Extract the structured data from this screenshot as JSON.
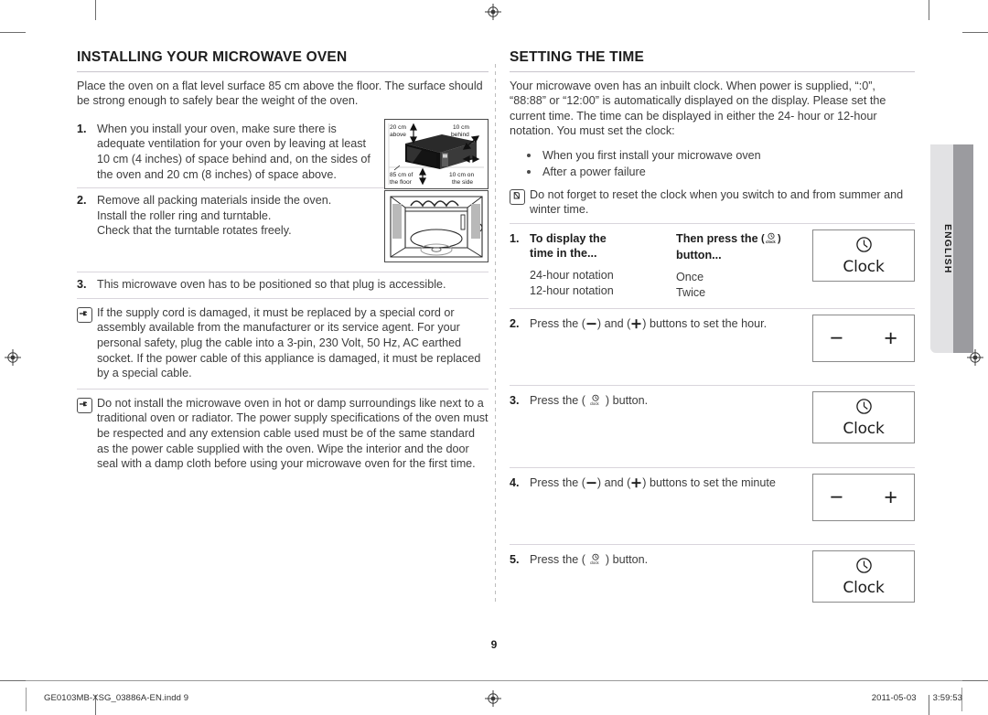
{
  "page": {
    "number": "9",
    "language_tab": "ENGLISH"
  },
  "left_column": {
    "heading": "INSTALLING YOUR MICROWAVE OVEN",
    "intro": "Place the oven on a flat level surface 85 cm above the floor. The surface should be strong enough to safely bear the weight of the oven.",
    "steps": [
      {
        "number": "1.",
        "text": "When you install your oven, make sure there is adequate ventilation for your oven by leaving at least 10 cm (4 inches) of space behind and, on the sides of the oven and 20 cm (8 inches) of space above.",
        "illustration": "oven-clearance-diagram",
        "illustration_labels": {
          "above": "20 cm above",
          "behind": "10 cm behind",
          "floor": "85 cm of the floor",
          "side": "10 cm on the side"
        }
      },
      {
        "number": "2.",
        "text": "Remove all packing materials inside the oven. Install the roller ring and turntable. Check that the turntable rotates freely.",
        "illustration": "oven-interior-turntable-diagram"
      },
      {
        "number": "3.",
        "text": "This microwave oven has to be positioned so that plug is accessible."
      }
    ],
    "notes": [
      {
        "icon": "pointing-hand-icon",
        "text": "If the supply cord is damaged, it must be replaced by a special cord or assembly available from the manufacturer or its service agent. For your personal safety, plug the cable into a 3-pin, 230 Volt, 50 Hz, AC earthed socket. If the power cable of this appliance is damaged, it must be replaced by a special cable."
      },
      {
        "icon": "pointing-hand-icon",
        "text": "Do not install the microwave oven in hot or damp surroundings like next to a traditional oven or radiator. The power supply specifications of the oven must be respected and any extension cable used must be of the same standard as the power cable supplied with the oven. Wipe the interior and the door seal with a damp cloth before using your microwave oven for the first time."
      }
    ]
  },
  "right_column": {
    "heading": "SETTING THE TIME",
    "intro": "Your microwave oven has an inbuilt clock. When power is supplied, “:0”, “88:88” or “12:00” is automatically displayed on the display. Please set the current time. The time can be displayed in either the 24- hour or 12-hour notation. You must set the clock:",
    "bullets": [
      "When you first install your microwave oven",
      "After a power failure"
    ],
    "note": {
      "icon": "note-pen-icon",
      "text": "Do not forget to reset the clock when you switch to and from summer and winter time."
    },
    "steps": [
      {
        "number": "1.",
        "table": {
          "headers": [
            "To display the time in the...",
            "Then press the (clock) button..."
          ],
          "rows": [
            [
              "24-hour notation",
              "Once"
            ],
            [
              "12-hour notation",
              "Twice"
            ]
          ]
        },
        "button": {
          "type": "clock",
          "label": "Clock"
        }
      },
      {
        "number": "2.",
        "text_parts": [
          "Press the (",
          ") and (",
          ") buttons to set the hour."
        ],
        "button": {
          "type": "plusminus",
          "minus": "−",
          "plus": "+"
        }
      },
      {
        "number": "3.",
        "text_parts": [
          "Press the (",
          ") button."
        ],
        "button": {
          "type": "clock",
          "label": "Clock"
        }
      },
      {
        "number": "4.",
        "text_parts": [
          "Press the (",
          ") and (",
          ") buttons to set the minute"
        ],
        "button": {
          "type": "plusminus",
          "minus": "−",
          "plus": "+"
        }
      },
      {
        "number": "5.",
        "text_parts": [
          "Press the (",
          ") button."
        ],
        "button": {
          "type": "clock",
          "label": "Clock"
        }
      }
    ]
  },
  "footer": {
    "file": "GE0103MB-XSG_03886A-EN.indd   9",
    "date": "2011-05-03",
    "time": "3:59:53"
  },
  "colors": {
    "text": "#3c3c3c",
    "heading": "#1d1d1d",
    "rule": "#d9d5dc",
    "tab_bg": "#e2e2e4",
    "tab_stripe": "#9b9b9f"
  }
}
